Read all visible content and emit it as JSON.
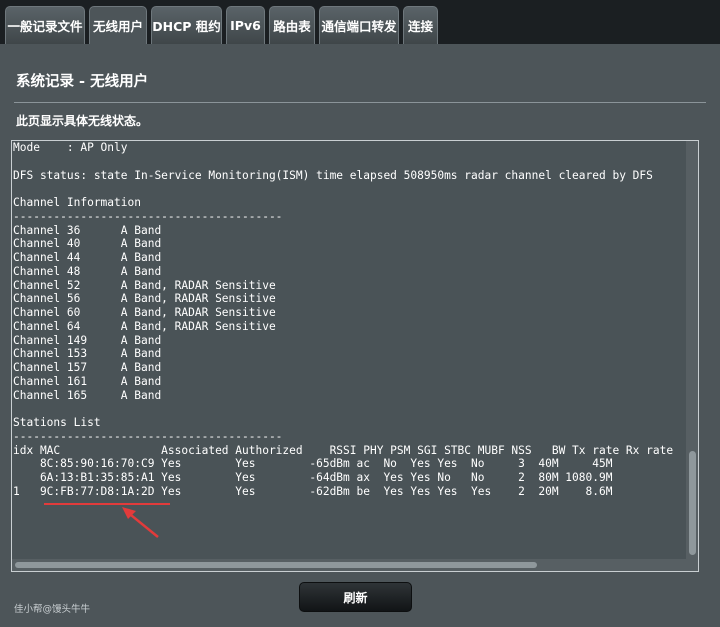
{
  "tabs": [
    {
      "label": "一般记录文件",
      "active": false
    },
    {
      "label": "无线用户",
      "active": true
    },
    {
      "label": "DHCP 租约",
      "active": false
    },
    {
      "label": "IPv6",
      "active": false
    },
    {
      "label": "路由表",
      "active": false
    },
    {
      "label": "通信端口转发",
      "active": false
    },
    {
      "label": "连接",
      "active": false
    }
  ],
  "page": {
    "title": "系统记录 - 无线用户",
    "description": "此页显示具体无线状态。"
  },
  "log": {
    "lines": [
      "Mode    : AP Only",
      "",
      "DFS status: state In-Service Monitoring(ISM) time elapsed 508950ms radar channel cleared by DFS",
      "",
      "Channel Information",
      "----------------------------------------",
      "Channel 36      A Band",
      "Channel 40      A Band",
      "Channel 44      A Band",
      "Channel 48      A Band",
      "Channel 52      A Band, RADAR Sensitive",
      "Channel 56      A Band, RADAR Sensitive",
      "Channel 60      A Band, RADAR Sensitive",
      "Channel 64      A Band, RADAR Sensitive",
      "Channel 149     A Band",
      "Channel 153     A Band",
      "Channel 157     A Band",
      "Channel 161     A Band",
      "Channel 165     A Band",
      "",
      "Stations List",
      "----------------------------------------",
      "idx MAC               Associated Authorized    RSSI PHY PSM SGI STBC MUBF NSS   BW Tx rate Rx rate",
      "    8C:85:90:16:70:C9 Yes        Yes        -65dBm ac  No  Yes Yes  No     3  40M     45M",
      "    6A:13:B1:35:85:A1 Yes        Yes        -64dBm ax  Yes Yes No   No     2  80M 1080.9M",
      "1   9C:FB:77:D8:1A:2D Yes        Yes        -62dBm be  Yes Yes Yes  Yes    2  20M    8.6M"
    ]
  },
  "buttons": {
    "refresh": "刷新"
  },
  "watermark": "佳小帮@馒头牛牛",
  "colors": {
    "panel_bg": "#4d5559",
    "annotation_red": "#e23b3b"
  }
}
